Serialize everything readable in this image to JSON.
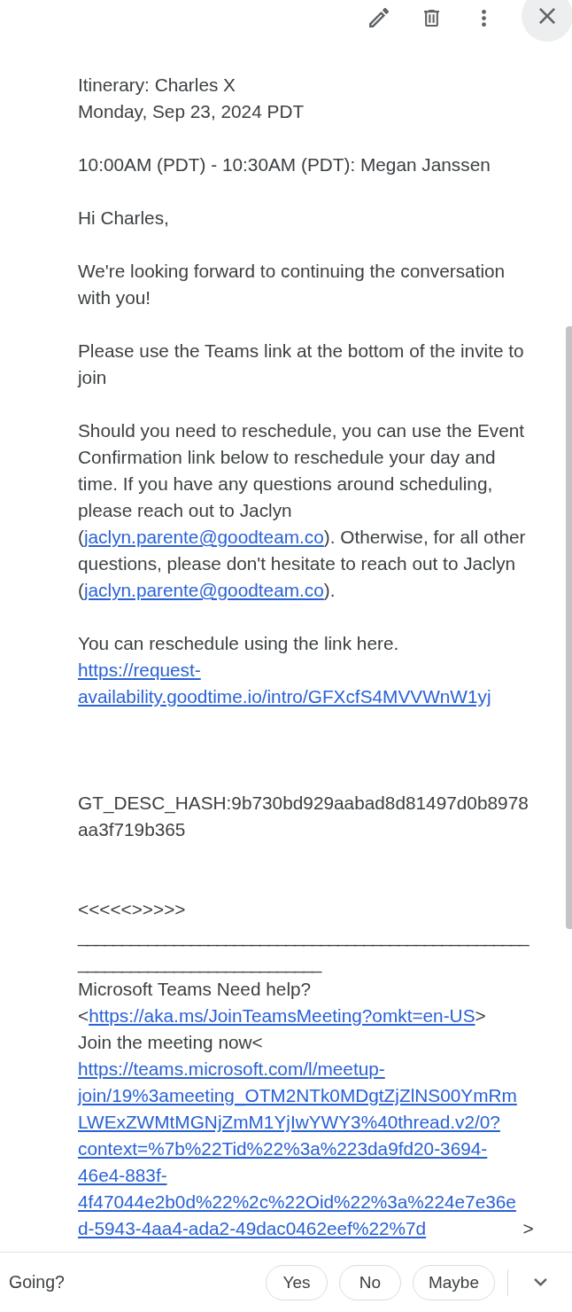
{
  "body": [
    {
      "kind": "paragraph",
      "lines": [
        [
          {
            "kind": "text",
            "text": "Itinerary: Charles X"
          }
        ],
        [
          {
            "kind": "text",
            "text": "Monday, Sep 23, 2024 PDT"
          }
        ]
      ]
    },
    {
      "kind": "paragraph",
      "lines": [
        [
          {
            "kind": "text",
            "text": "10:00AM (PDT) - 10:30AM (PDT): Megan Janssen"
          }
        ]
      ]
    },
    {
      "kind": "paragraph",
      "lines": [
        [
          {
            "kind": "text",
            "text": "Hi Charles,"
          }
        ]
      ]
    },
    {
      "kind": "paragraph",
      "lines": [
        [
          {
            "kind": "text",
            "text": "We're looking forward to continuing the conversation with you!"
          }
        ]
      ]
    },
    {
      "kind": "paragraph",
      "lines": [
        [
          {
            "kind": "text",
            "text": "Please use the Teams link at the bottom of the invite to join"
          }
        ]
      ]
    },
    {
      "kind": "paragraph",
      "lines": [
        [
          {
            "kind": "text",
            "text": "Should you need to reschedule, you can use the Event Confirmation link below to reschedule your day and time. If you have any questions around scheduling, please reach out to Jaclyn ("
          },
          {
            "kind": "email",
            "text": "jaclyn.parente@goodteam.co"
          },
          {
            "kind": "text",
            "text": "). Otherwise, for all other questions, please don't hesitate to reach out to Jaclyn ("
          },
          {
            "kind": "email",
            "text": "jaclyn.parente@goodteam.co"
          },
          {
            "kind": "text",
            "text": ")."
          }
        ]
      ]
    },
    {
      "kind": "paragraph",
      "lines": [
        [
          {
            "kind": "text",
            "text": "You can reschedule using the link here."
          }
        ],
        [
          {
            "kind": "url",
            "text": "https://request-availability.goodtime.io/intro/GFXcfS4MVVWnW1yj"
          }
        ]
      ]
    },
    {
      "kind": "blank"
    },
    {
      "kind": "blank"
    },
    {
      "kind": "paragraph",
      "lines": [
        [
          {
            "kind": "text",
            "text": "GT_DESC_HASH:9b730bd929aabad8d81497d0b8978aa3f719b365"
          }
        ]
      ]
    },
    {
      "kind": "blank"
    },
    {
      "kind": "paragraph",
      "lines": [
        [
          {
            "kind": "text",
            "text": "<<<<<>>>>>"
          }
        ],
        [
          {
            "kind": "rule",
            "text": "________________________________________________________________________________"
          }
        ],
        [
          {
            "kind": "text",
            "text": "Microsoft Teams Need help?"
          }
        ],
        [
          {
            "kind": "text",
            "text": "<"
          },
          {
            "kind": "url",
            "text": "https://aka.ms/JoinTeamsMeeting?omkt=en-US"
          },
          {
            "kind": "text",
            "text": ">"
          }
        ],
        [
          {
            "kind": "text",
            "text": "Join the meeting now<"
          },
          {
            "kind": "url",
            "text": "https://teams.microsoft.com/l/meetup-join/19%3ameeting_OTM2NTk0MDgtZjZlNS00YmRmLWExZWMtMGNjZmM1YjIwYWY3%40thread.v2/0?context=%7b%22Tid%22%3a%223da9fd20-3694-46e4-883f-4f47044e2b0d%22%2c%22Oid%22%3a%224e7e36ed-5943-4aa4-ada2-49dac0462eef%22%7d"
          },
          {
            "kind": "text",
            "text": ">"
          }
        ]
      ]
    }
  ],
  "rsvp": {
    "prompt": "Going?",
    "options": [
      {
        "label": "Yes",
        "selected": false
      },
      {
        "label": "No",
        "selected": false
      },
      {
        "label": "Maybe",
        "selected": false
      }
    ]
  }
}
